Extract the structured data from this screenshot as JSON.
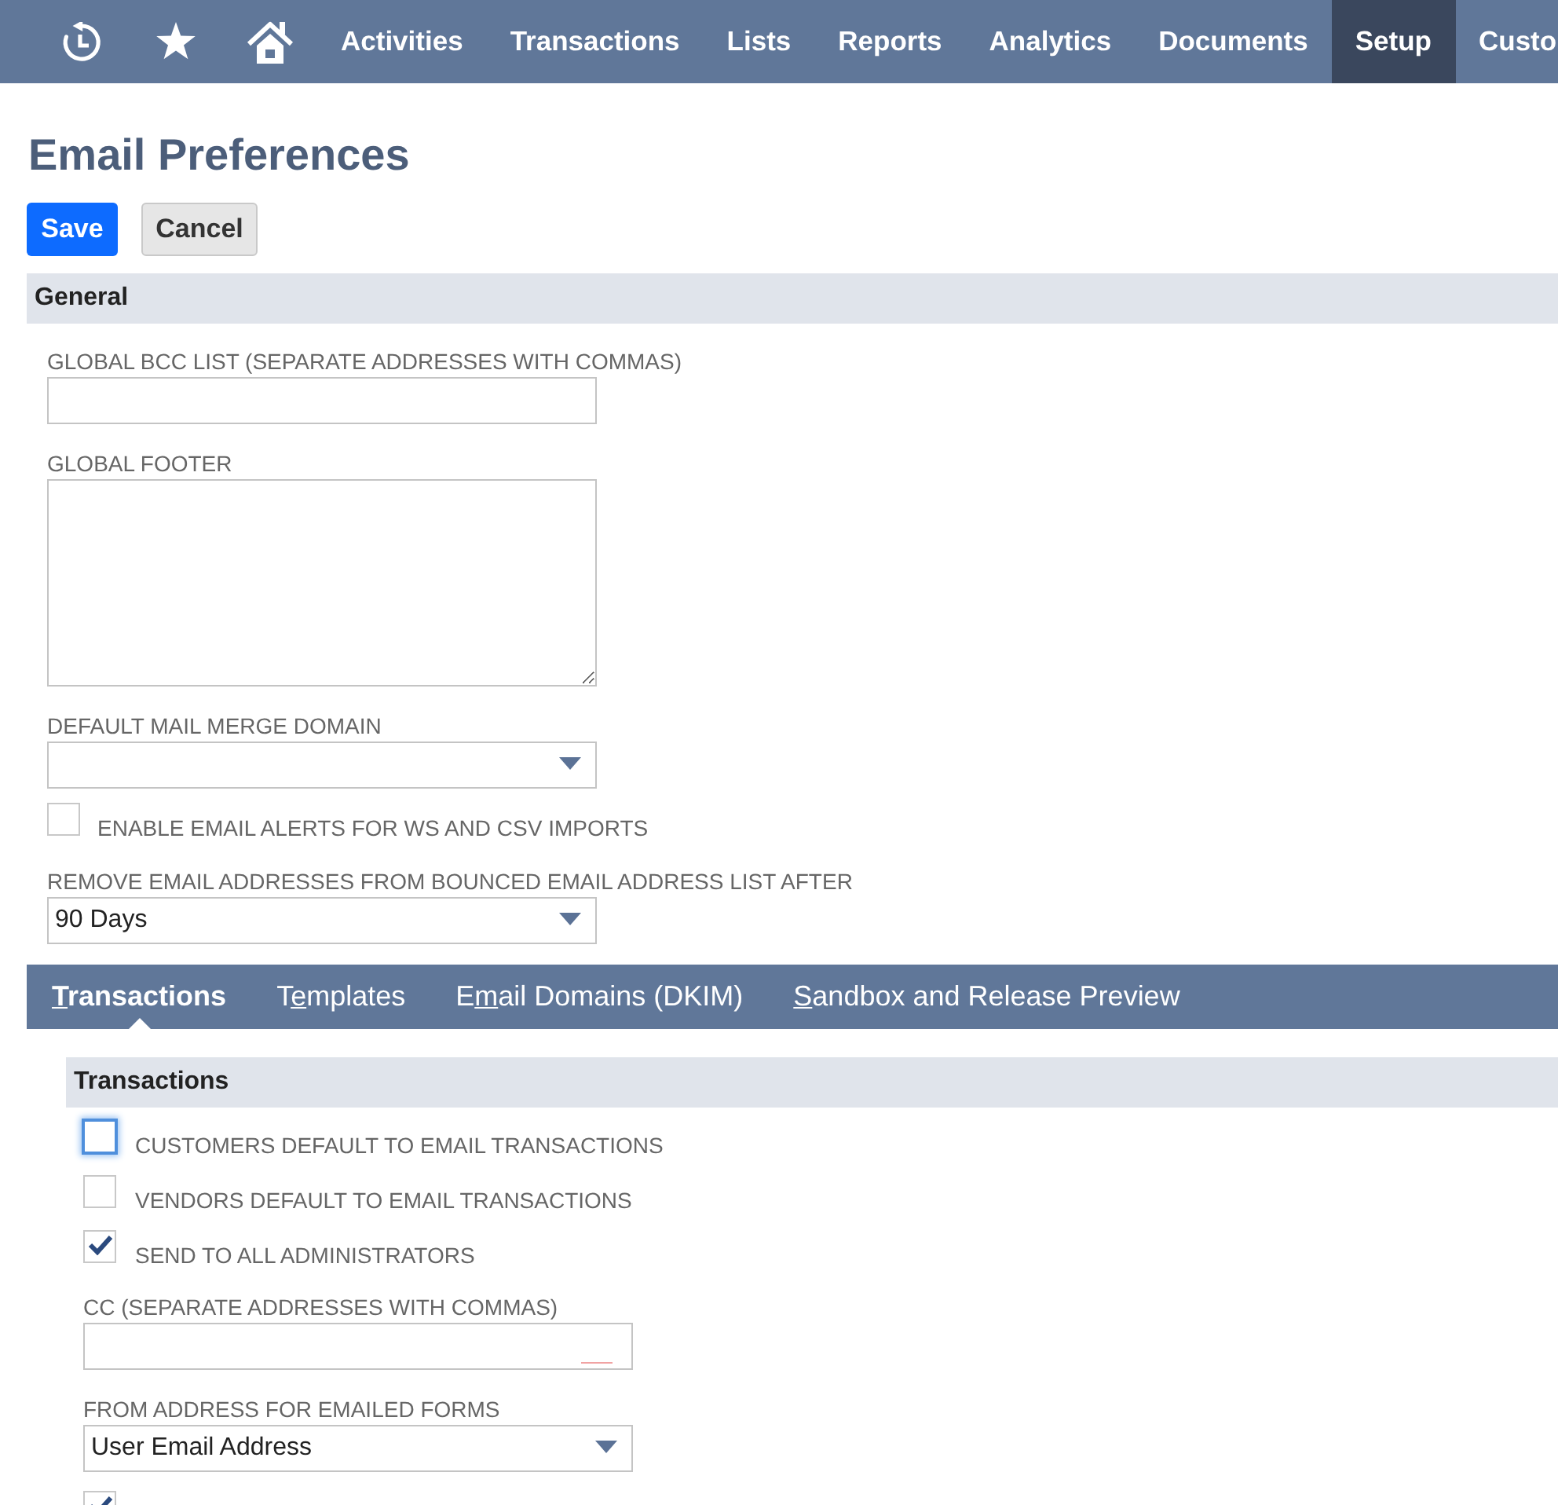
{
  "nav": {
    "items": [
      {
        "label": "Activities",
        "selected": false
      },
      {
        "label": "Transactions",
        "selected": false
      },
      {
        "label": "Lists",
        "selected": false
      },
      {
        "label": "Reports",
        "selected": false
      },
      {
        "label": "Analytics",
        "selected": false
      },
      {
        "label": "Documents",
        "selected": false
      },
      {
        "label": "Setup",
        "selected": true
      },
      {
        "label": "Custo",
        "selected": false
      }
    ]
  },
  "page": {
    "title": "Email Preferences"
  },
  "buttons": [
    {
      "label": "Save",
      "kind": "save"
    },
    {
      "label": "Cancel",
      "kind": "cancel"
    }
  ],
  "general": {
    "heading": "General",
    "fields": [
      {
        "kind": "text",
        "label": "GLOBAL BCC LIST (SEPARATE ADDRESSES WITH COMMAS)",
        "mark": false
      },
      {
        "kind": "textarea",
        "label": "GLOBAL FOOTER"
      },
      {
        "kind": "select",
        "label": "DEFAULT MAIL MERGE DOMAIN"
      },
      {
        "kind": "checkbox",
        "label": "ENABLE EMAIL ALERTS FOR WS AND CSV IMPORTS",
        "checked": false,
        "focused": false
      },
      {
        "kind": "select",
        "label": "REMOVE EMAIL ADDRESSES FROM BOUNCED EMAIL ADDRESS LIST AFTER",
        "value": "90 Days"
      }
    ]
  },
  "tabs": [
    {
      "key": "T",
      "post": "ransactions",
      "selected": true
    },
    {
      "pre": "T",
      "key": "e",
      "post": "mplates",
      "selected": false
    },
    {
      "pre": "E",
      "key": "m",
      "post": "ail Domains (DKIM)",
      "selected": false
    },
    {
      "key": "S",
      "post": "andbox and Release Preview",
      "selected": false
    }
  ],
  "transactions": {
    "heading": "Transactions",
    "fields": [
      {
        "kind": "checkbox",
        "label": "CUSTOMERS DEFAULT TO EMAIL TRANSACTIONS",
        "checked": false,
        "focused": true
      },
      {
        "kind": "checkbox",
        "label": "VENDORS DEFAULT TO EMAIL TRANSACTIONS",
        "checked": false,
        "focused": false
      },
      {
        "kind": "checkbox",
        "label": "SEND TO ALL ADMINISTRATORS",
        "checked": true,
        "focused": false
      },
      {
        "kind": "text",
        "label": "CC (SEPARATE ADDRESSES WITH COMMAS)",
        "mark": true
      },
      {
        "kind": "select",
        "label": "FROM ADDRESS FOR EMAILED FORMS",
        "value": "User Email Address"
      },
      {
        "kind": "checkbox",
        "checked": true,
        "focused": false
      }
    ]
  }
}
